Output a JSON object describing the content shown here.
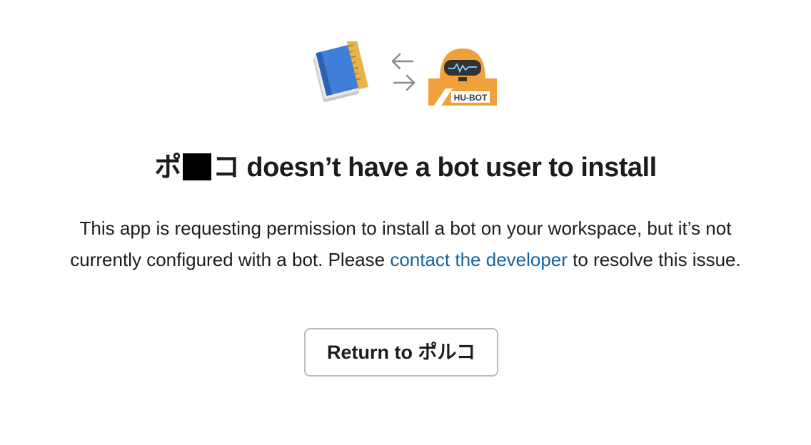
{
  "header": {
    "app_icon": "book-ruler-icon",
    "swap_icon": "swap-arrows-icon",
    "bot_icon": "hubot-icon",
    "bot_label": "HU-BOT"
  },
  "title": {
    "prefix": "ポ",
    "suffix": "コ doesn’t have a bot user to install"
  },
  "description": {
    "text_before": "This app is requesting permission to install a bot on your workspace, but it’s not currently configured with a bot. Please ",
    "link_text": "contact the developer",
    "text_after": " to resolve this issue."
  },
  "return_button": {
    "label": "Return to ポルコ"
  },
  "colors": {
    "link": "#1264a3",
    "text": "#1d1c1d",
    "button_border": "#bcbcbc",
    "bot_orange": "#f0a13a",
    "book_blue": "#3f7fd9"
  }
}
